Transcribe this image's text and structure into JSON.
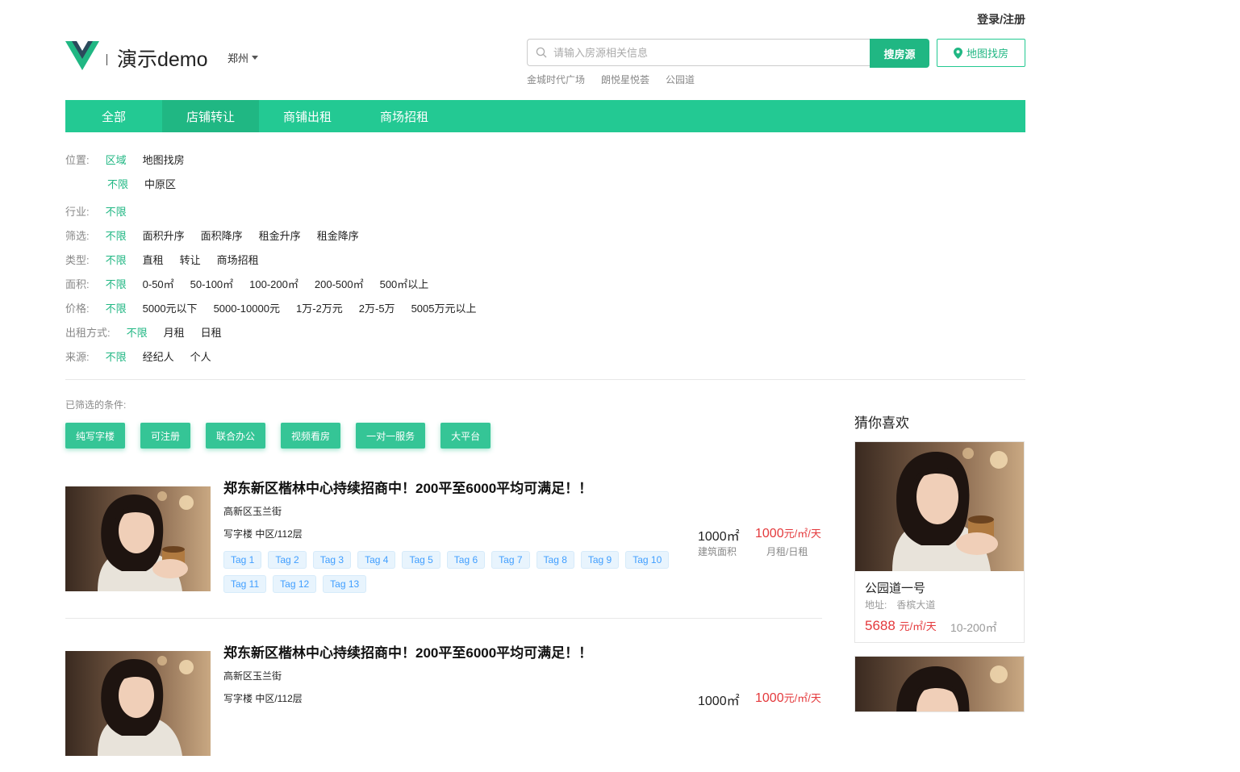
{
  "header": {
    "login": "登录/注册",
    "app_title": "演示demo",
    "city": "郑州",
    "search_placeholder": "请输入房源相关信息",
    "search_button": "搜房源",
    "map_button": "地图找房",
    "hot_searches": [
      "金城时代广场",
      "朗悦星悦荟",
      "公园道"
    ]
  },
  "nav": {
    "tabs": [
      "全部",
      "店铺转让",
      "商铺出租",
      "商场招租"
    ],
    "active_index": 1
  },
  "filters": {
    "location": {
      "label": "位置:",
      "options": [
        "区域",
        "地图找房"
      ],
      "sub_options": [
        "不限",
        "中原区"
      ]
    },
    "industry": {
      "label": "行业:",
      "options": [
        "不限"
      ]
    },
    "sort": {
      "label": "筛选:",
      "options": [
        "不限",
        "面积升序",
        "面积降序",
        "租金升序",
        "租金降序"
      ]
    },
    "type": {
      "label": "类型:",
      "options": [
        "不限",
        "直租",
        "转让",
        "商场招租"
      ]
    },
    "area": {
      "label": "面积:",
      "options": [
        "不限",
        "0-50㎡",
        "50-100㎡",
        "100-200㎡",
        "200-500㎡",
        "500㎡以上"
      ]
    },
    "price": {
      "label": "价格:",
      "options": [
        "不限",
        "5000元以下",
        "5000-10000元",
        "1万-2万元",
        "2万-5万",
        "5005万元以上"
      ]
    },
    "rent_mode": {
      "label": "出租方式:",
      "options": [
        "不限",
        "月租",
        "日租"
      ]
    },
    "source": {
      "label": "来源:",
      "options": [
        "不限",
        "经纪人",
        "个人"
      ]
    }
  },
  "selected": {
    "label": "已筛选的条件:",
    "chips": [
      "纯写字楼",
      "可注册",
      "联合办公",
      "视频看房",
      "一对一服务",
      "大平台"
    ]
  },
  "listings": [
    {
      "title": "郑东新区楷林中心持续招商中！200平至6000平均可满足！！",
      "address": "高新区玉兰街",
      "type": "写字楼 中区/112层",
      "tags": [
        "Tag 1",
        "Tag 2",
        "Tag 3",
        "Tag 4",
        "Tag 5",
        "Tag 6",
        "Tag 7",
        "Tag 8",
        "Tag 9",
        "Tag 10",
        "Tag 11",
        "Tag 12",
        "Tag 13"
      ],
      "area": "1000㎡",
      "area_label": "建筑面积",
      "price_value": "1000",
      "price_unit": "元/㎡/天",
      "price_label": "月租/日租"
    },
    {
      "title": "郑东新区楷林中心持续招商中！200平至6000平均可满足！！",
      "address": "高新区玉兰街",
      "type": "写字楼 中区/112层",
      "tags": [],
      "area": "1000㎡",
      "area_label": "",
      "price_value": "1000",
      "price_unit": "元/㎡/天",
      "price_label": ""
    }
  ],
  "recommend": {
    "title": "猜你喜欢",
    "cards": [
      {
        "name": "公园道一号",
        "address_label": "地址:",
        "address": "香槟大道",
        "price": "5688",
        "price_unit": "元/㎡/天",
        "size": "10-200㎡"
      },
      {
        "name": "",
        "address_label": "",
        "address": "",
        "price": "",
        "price_unit": "",
        "size": ""
      }
    ]
  },
  "colors": {
    "primary": "#23c993",
    "primary_dark": "#20b783",
    "price": "#e4393c",
    "tag_text": "#409eff"
  }
}
